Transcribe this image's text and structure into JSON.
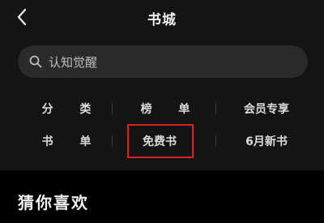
{
  "header": {
    "title": "书城",
    "back_icon": "chevron-left-icon"
  },
  "search": {
    "placeholder": "认知觉醒",
    "icon": "search-icon"
  },
  "menu": {
    "row1": [
      "分 类",
      "榜 单",
      "会员专享"
    ],
    "row2": [
      "书 单",
      "免费书",
      "6月新书"
    ]
  },
  "section": {
    "title": "猜你喜欢"
  },
  "colors": {
    "background": "#141414",
    "search_bg": "#2a2a2a",
    "highlight": "#d8211f",
    "bottom_bg": "#000000"
  }
}
